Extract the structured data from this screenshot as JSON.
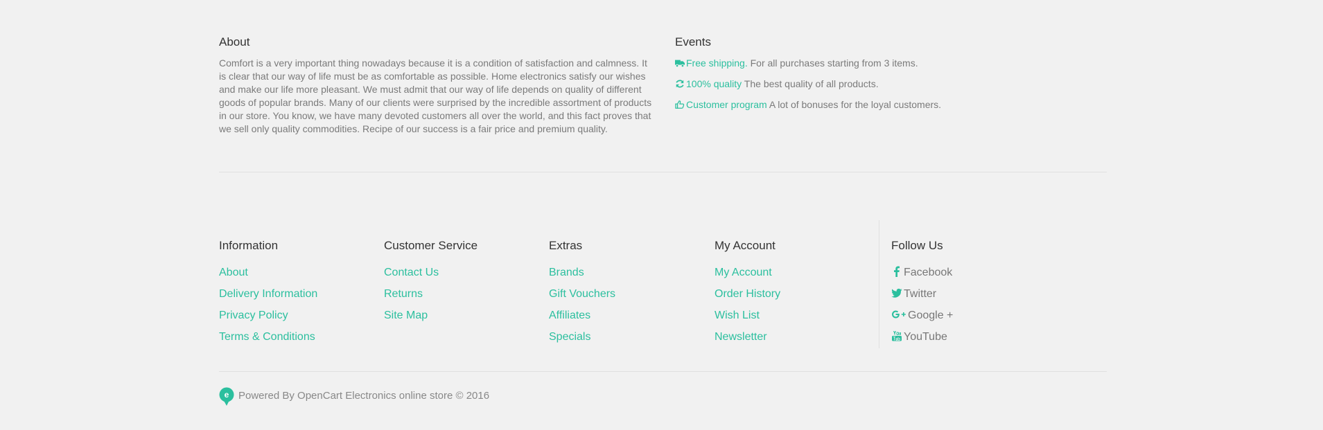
{
  "about": {
    "title": "About",
    "text": "Comfort is a very important thing nowadays because it is a condition of satisfaction and calmness. It is clear that our way of life must be as comfortable as possible. Home electronics satisfy our wishes and make our life more pleasant. We must admit that our way of life depends on quality of different goods of popular brands. Many of our clients were surprised by the incredible assortment of products in our store. You know, we have many devoted customers all over the world, and this fact proves that we sell only quality commodities. Recipe of our success is a fair price and premium quality."
  },
  "events": {
    "title": "Events",
    "items": [
      {
        "icon": "truck-icon",
        "highlight": "Free shipping.",
        "text": " For all purchases starting from 3 items."
      },
      {
        "icon": "refresh-icon",
        "highlight": "100% quality",
        "text": " The best quality of all products."
      },
      {
        "icon": "thumbs-up-icon",
        "highlight": "Customer program",
        "text": " A lot of bonuses for the loyal customers."
      }
    ]
  },
  "footer": {
    "information": {
      "title": "Information",
      "links": [
        "About",
        "Delivery Information",
        "Privacy Policy",
        "Terms & Conditions"
      ]
    },
    "customer_service": {
      "title": "Customer Service",
      "links": [
        "Contact Us",
        "Returns",
        "Site Map"
      ]
    },
    "extras": {
      "title": "Extras",
      "links": [
        "Brands",
        "Gift Vouchers",
        "Affiliates",
        "Specials"
      ]
    },
    "my_account": {
      "title": "My Account",
      "links": [
        "My Account",
        "Order History",
        "Wish List",
        "Newsletter"
      ]
    },
    "follow_us": {
      "title": "Follow Us",
      "links": [
        {
          "icon": "facebook-icon",
          "label": "Facebook"
        },
        {
          "icon": "twitter-icon",
          "label": "Twitter"
        },
        {
          "icon": "google-plus-icon",
          "label": "Google +"
        },
        {
          "icon": "youtube-icon",
          "label": "YouTube"
        }
      ]
    }
  },
  "powered": "Powered By OpenCart Electronics online store © 2016",
  "logo_letter": "e",
  "colors": {
    "accent": "#2bbf9e",
    "background": "#f1f1f1",
    "heading": "#333333",
    "text": "#777777"
  }
}
